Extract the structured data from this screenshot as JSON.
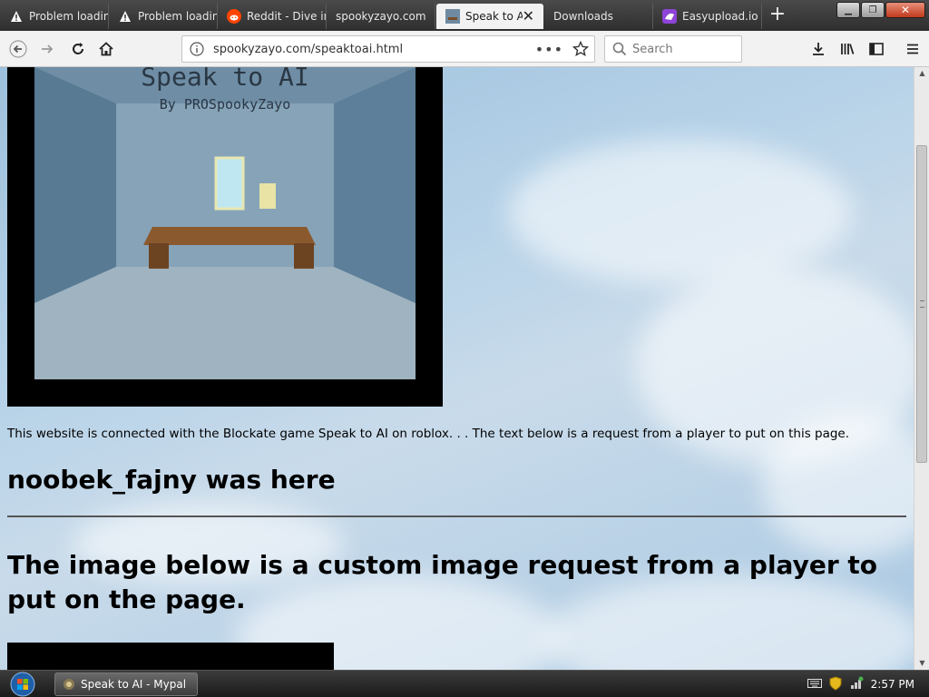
{
  "browser": {
    "tabs": [
      {
        "title": "Problem loadin",
        "icon": "warning-icon"
      },
      {
        "title": "Problem loadin",
        "icon": "warning-icon"
      },
      {
        "title": "Reddit - Dive in",
        "icon": "reddit-icon"
      },
      {
        "title": "spookyzayo.com",
        "icon": "none"
      },
      {
        "title": "Speak to AI",
        "icon": "site-icon",
        "active": true
      },
      {
        "title": "Downloads",
        "icon": "none"
      },
      {
        "title": "Easyupload.io",
        "icon": "easyupload-icon"
      }
    ],
    "url": "spookyzayo.com/speaktoai.html",
    "search_placeholder": "Search"
  },
  "page": {
    "hero_title": "Speak to AI",
    "hero_byline": "By PROSpookyZayo",
    "intro_text": "This website is connected with the Blockate game Speak to AI on roblox. . . The text below is a request from a player to put on this page.",
    "player_note": "noobek_fajny was here",
    "image_request_heading": "The image below is a custom image request from a player to put on the page."
  },
  "taskbar": {
    "window_label": "Speak to AI - Mypal",
    "clock": "2:57 PM"
  },
  "colors": {
    "sky": "#b6d2e8",
    "frame": "#000000",
    "table": "#8a5a2e"
  }
}
